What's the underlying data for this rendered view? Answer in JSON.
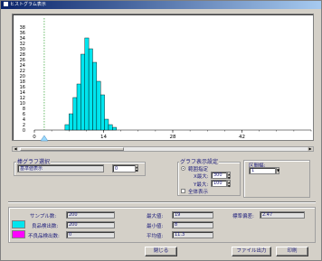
{
  "window": {
    "title": "ヒストグラム表示"
  },
  "chart_data": {
    "type": "bar",
    "title": "",
    "xlabel": "",
    "ylabel": "",
    "xlim": [
      0,
      56
    ],
    "ylim": [
      0,
      40
    ],
    "x_ticks": [
      "0",
      "14",
      "28",
      "42"
    ],
    "y_ticks": [
      "0",
      "2",
      "4",
      "6",
      "8",
      "10",
      "12",
      "14",
      "16",
      "18",
      "20",
      "22",
      "24",
      "26",
      "28",
      "30",
      "32",
      "34",
      "36",
      "38"
    ],
    "bin_width": 0.8,
    "bins": [
      {
        "x": 6.6,
        "value": 2
      },
      {
        "x": 7.4,
        "value": 6
      },
      {
        "x": 8.2,
        "value": 12
      },
      {
        "x": 9.0,
        "value": 17
      },
      {
        "x": 9.8,
        "value": 28
      },
      {
        "x": 10.6,
        "value": 34
      },
      {
        "x": 11.4,
        "value": 30
      },
      {
        "x": 12.2,
        "value": 25
      },
      {
        "x": 13.0,
        "value": 18
      },
      {
        "x": 13.8,
        "value": 13
      },
      {
        "x": 14.6,
        "value": 4
      },
      {
        "x": 15.4,
        "value": 2
      },
      {
        "x": 16.2,
        "value": 1
      }
    ],
    "marker_x": 2,
    "bar_color": "#00e5ee",
    "marker_color": "#2aa02a"
  },
  "display_data": {
    "legend": "棒グラフ選択",
    "value": "基準値表示",
    "count": "0"
  },
  "graph_settings": {
    "legend": "グラフ表示設定",
    "radio_label": "範囲指定",
    "xmax_label": "X最大:",
    "xmax_value": "300",
    "ymax_label": "Y最大:",
    "ymax_value": "100",
    "all_label": "全体表示"
  },
  "interval": {
    "label": "区間幅:",
    "value": "1"
  },
  "stats": {
    "samples_label": "サンプル数:",
    "samples_value": "200",
    "pass_label": "良品検出数:",
    "pass_value": "200",
    "fail_label": "不良品検出数:",
    "fail_value": "0",
    "max_label": "最大値:",
    "max_value": "19",
    "min_label": "最小値:",
    "min_value": "8",
    "avg_label": "平均値:",
    "avg_value": "11.3",
    "sd_label": "標準偏差:",
    "sd_value": "2.47",
    "pass_color": "#00e5ee",
    "fail_color": "#ff00ff"
  },
  "buttons": {
    "close": "閉じる",
    "file_out": "ファイル出力",
    "print": "印刷"
  }
}
